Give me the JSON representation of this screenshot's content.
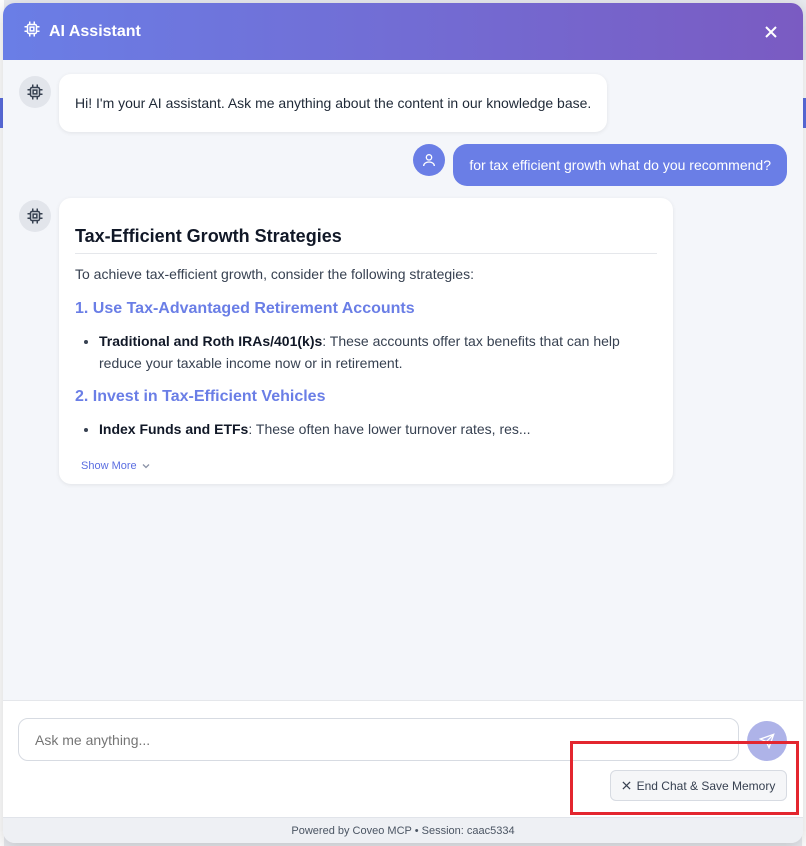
{
  "header": {
    "title": "AI Assistant",
    "close_icon": "close-icon"
  },
  "messages": {
    "greeting": "Hi! I'm your AI assistant. Ask me anything about the content in our knowledge base.",
    "user_query": "for tax efficient growth what do you recommend?",
    "response": {
      "title": "Tax-Efficient Growth Strategies",
      "intro": "To achieve tax-efficient growth, consider the following strategies:",
      "sections": [
        {
          "heading": "1. Use Tax-Advantaged Retirement Accounts",
          "bullet_bold": "Traditional and Roth IRAs/401(k)s",
          "bullet_text": ": These accounts offer tax benefits that can help reduce your taxable income now or in retirement."
        },
        {
          "heading": "2. Invest in Tax-Efficient Vehicles",
          "bullet_bold": "Index Funds and ETFs",
          "bullet_text": ": These often have lower turnover rates, res..."
        }
      ],
      "show_more": "Show More"
    }
  },
  "input": {
    "placeholder": "Ask me anything..."
  },
  "end_chat_label": "End Chat & Save Memory",
  "footer": "Powered by Coveo MCP • Session: caac5334",
  "colors": {
    "accent": "#6a7ee6",
    "header_end": "#7a5bc2",
    "highlight": "#e3262f"
  }
}
